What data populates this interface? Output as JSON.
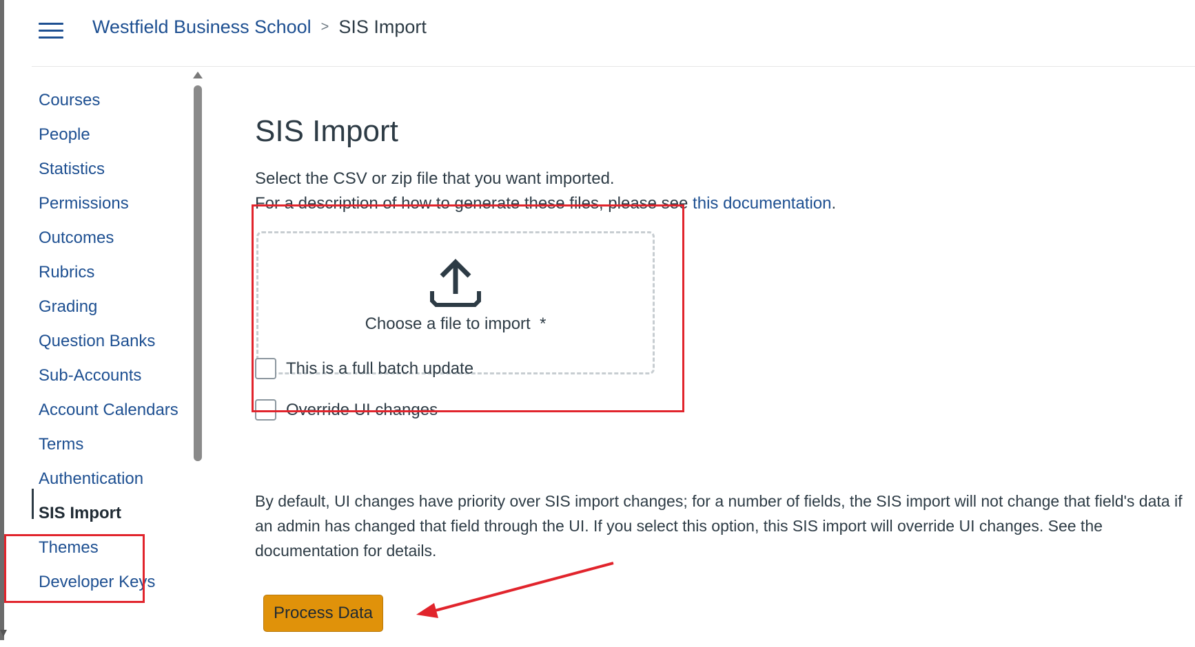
{
  "header": {
    "breadcrumb_root": "Westfield Business School",
    "breadcrumb_separator": ">",
    "breadcrumb_current": "SIS Import"
  },
  "sidebar": {
    "items": [
      {
        "label": "Courses"
      },
      {
        "label": "People"
      },
      {
        "label": "Statistics"
      },
      {
        "label": "Permissions"
      },
      {
        "label": "Outcomes"
      },
      {
        "label": "Rubrics"
      },
      {
        "label": "Grading"
      },
      {
        "label": "Question Banks"
      },
      {
        "label": "Sub-Accounts"
      },
      {
        "label": "Account Calendars"
      },
      {
        "label": "Terms"
      },
      {
        "label": "Authentication"
      },
      {
        "label": "SIS Import"
      },
      {
        "label": "Themes"
      },
      {
        "label": "Developer Keys"
      }
    ],
    "active_item": "SIS Import"
  },
  "main": {
    "title": "SIS Import",
    "description_line1": "Select the CSV or zip file that you want imported.",
    "description_line2_prefix": "For a description of how to generate these files, please see ",
    "description_line2_link": "this documentation",
    "description_line2_suffix": ".",
    "dropzone": {
      "label": "Choose a file to import",
      "required_marker": "*",
      "icon": "upload-icon"
    },
    "checkboxes": [
      {
        "label": "This is a full batch update",
        "checked": false
      },
      {
        "label": "Override UI changes",
        "checked": false
      }
    ],
    "help_text": "By default, UI changes have priority over SIS import changes; for a number of fields, the SIS import will not change that field's data if an admin has changed that field through the UI. If you select this option, this SIS import will override UI changes. See the documentation for details.",
    "process_button_label": "Process Data"
  },
  "colors": {
    "link": "#1d4f91",
    "text": "#2d3b45",
    "button": "#e0920a",
    "annotation": "#e1242c"
  }
}
